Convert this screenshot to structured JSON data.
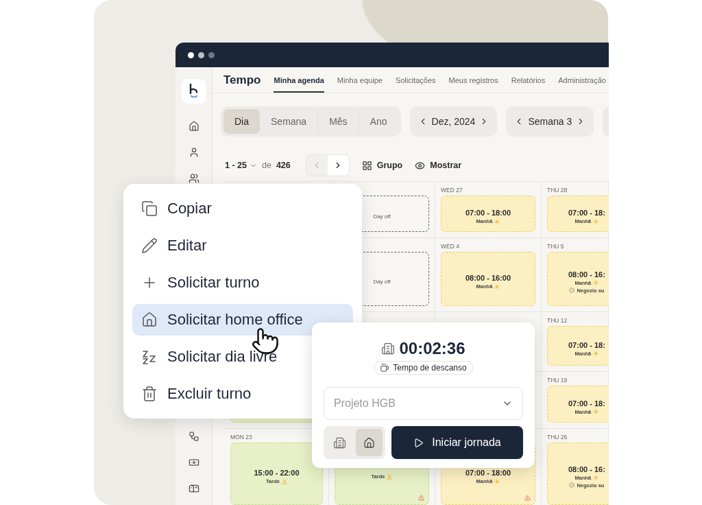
{
  "header": {
    "title": "Tempo",
    "tabs": [
      {
        "label": "Minha agenda",
        "selected": true
      },
      {
        "label": "Minha equipe",
        "selected": false
      },
      {
        "label": "Solicitações",
        "selected": false
      },
      {
        "label": "Meus registros",
        "selected": false
      },
      {
        "label": "Relatórios",
        "selected": false
      },
      {
        "label": "Administração",
        "selected": false
      }
    ]
  },
  "toolbar": {
    "views": [
      {
        "label": "Dia",
        "selected": true
      },
      {
        "label": "Semana",
        "selected": false
      },
      {
        "label": "Mês",
        "selected": false
      },
      {
        "label": "Ano",
        "selected": false
      }
    ],
    "month": "Dez, 2024",
    "week": "Semana 3"
  },
  "pagination": {
    "range": "1 - 25",
    "of": "de",
    "total": "426",
    "prev_disabled": true,
    "actions": [
      {
        "kind": "group",
        "label": "Grupo"
      },
      {
        "kind": "show",
        "label": "Mostrar"
      }
    ]
  },
  "calendar": {
    "rows": [
      {
        "cells": [
          {},
          {
            "card": {
              "kind": "day-off",
              "label": "Day off",
              "warning": false
            }
          },
          {
            "day": "WED 27",
            "card": {
              "kind": "morning",
              "time": "07:00 - 18:00",
              "label": "Manhã",
              "warning": false
            }
          },
          {
            "day": "THU 28",
            "card": {
              "kind": "morning",
              "time": "07:00 - 18:",
              "label": "Manhã"
            }
          }
        ]
      },
      {
        "cells": [
          {},
          {
            "card": {
              "kind": "day-off",
              "label": "Day off",
              "warning": false
            }
          },
          {
            "day": "WED 4",
            "card": {
              "kind": "morning",
              "time": "08:00 - 16:00",
              "label": "Manhã",
              "warning": false
            }
          },
          {
            "day": "THU 5",
            "card": {
              "kind": "morning",
              "time": "08:00 - 16:",
              "label": "Manhã",
              "location": "Negozio su"
            }
          }
        ]
      },
      {
        "cells": [
          {},
          {},
          {},
          {
            "day": "THU 12",
            "card": {
              "kind": "morning",
              "time": "07:00 - 18:",
              "label": "Manhã"
            }
          }
        ]
      },
      {
        "cells": [
          {
            "card": {
              "kind": "afternoon"
            }
          },
          {},
          {},
          {
            "day": "THU 19",
            "card": {
              "kind": "morning",
              "time": "07:00 - 18:",
              "label": "Manhã"
            }
          }
        ]
      },
      {
        "cells": [
          {
            "day": "MON 23",
            "card": {
              "kind": "afternoon",
              "time": "15:00 - 22:00",
              "label": "Tarde",
              "warning": false
            }
          },
          {
            "card": {
              "kind": "afternoon",
              "label": "Tarde",
              "warning": true
            }
          },
          {
            "card": {
              "kind": "morning",
              "time": "07:00 - 18:00",
              "label": "Manhã",
              "warning": true
            }
          },
          {
            "day": "THU 26",
            "card": {
              "kind": "morning",
              "time": "08:00 - 16:",
              "label": "Manhã",
              "location": "Negozio su"
            }
          }
        ]
      }
    ]
  },
  "context_menu": {
    "items": [
      {
        "kind": "copy",
        "label": "Copiar",
        "selected": false
      },
      {
        "kind": "edit",
        "label": "Editar",
        "selected": false
      },
      {
        "kind": "add",
        "label": "Solicitar turno",
        "selected": false
      },
      {
        "kind": "home",
        "label": "Solicitar home office",
        "selected": true
      },
      {
        "kind": "sleep",
        "label": "Solicitar dia livre",
        "selected": false
      },
      {
        "kind": "delete",
        "label": "Excluir turno",
        "selected": false
      }
    ]
  },
  "timer_popup": {
    "time": "00:02:36",
    "status": "Tempo de descanso",
    "project_select": {
      "placeholder": "Projeto HGB"
    },
    "modes": [
      {
        "kind": "office",
        "selected": false
      },
      {
        "kind": "home",
        "selected": true
      }
    ],
    "start_button": "Iniciar jornada"
  }
}
